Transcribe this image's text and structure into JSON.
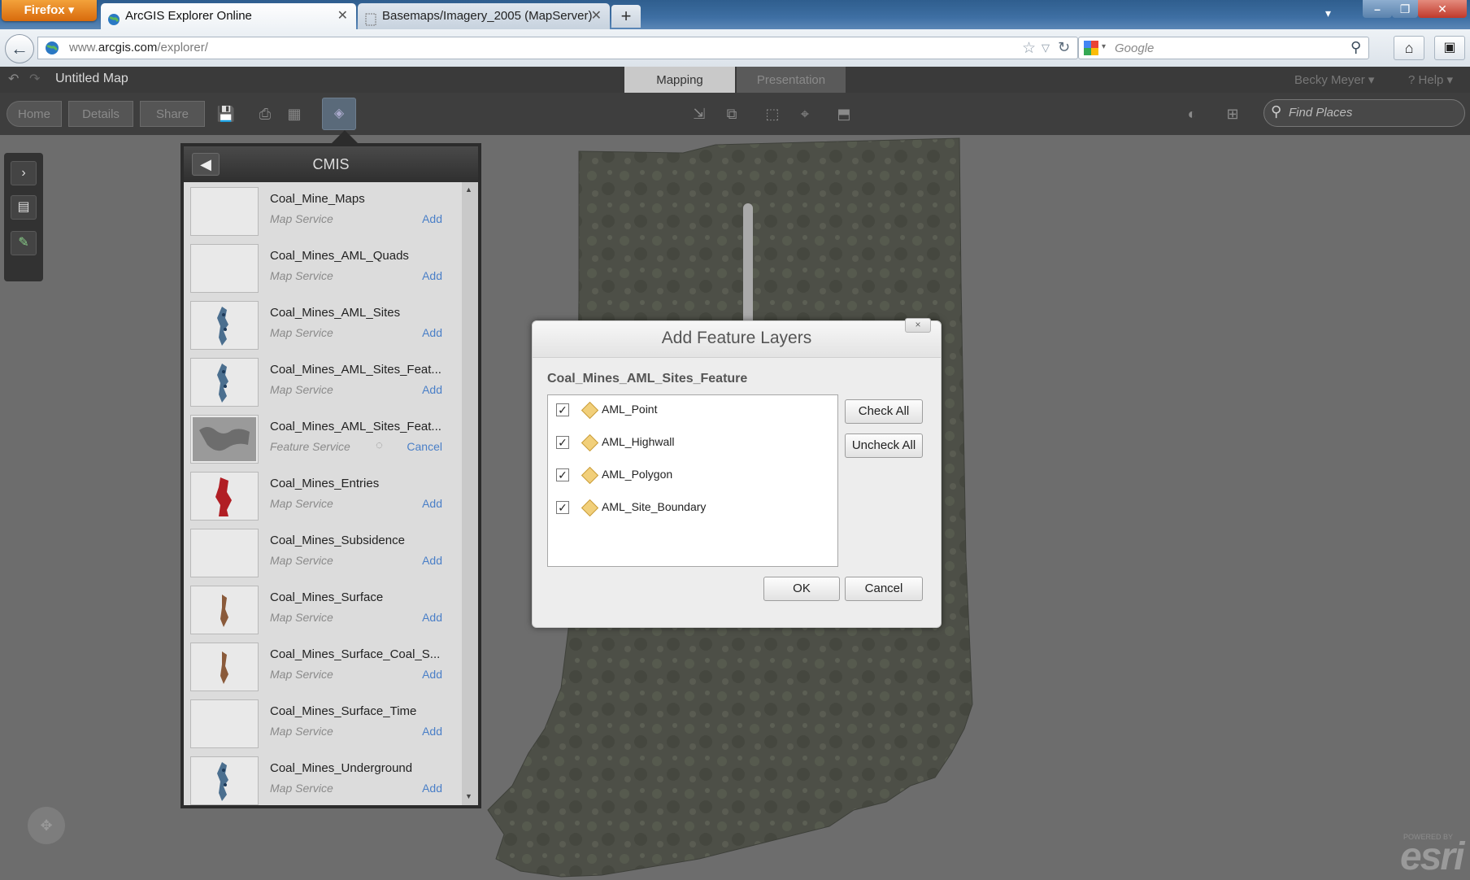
{
  "browser": {
    "app_button": "Firefox",
    "tabs": [
      {
        "title": "ArcGIS Explorer Online",
        "active": true
      },
      {
        "title": "Basemaps/Imagery_2005 (MapServer)",
        "active": false
      }
    ],
    "url_prefix": "www.",
    "url_domain": "arcgis.com",
    "url_path": "/explorer/",
    "search_placeholder": "Google",
    "new_tab": "+"
  },
  "app": {
    "map_title": "Untitled Map",
    "mode_tabs": [
      {
        "label": "Mapping",
        "active": true
      },
      {
        "label": "Presentation",
        "active": false
      }
    ],
    "user": "Becky Meyer",
    "help": "Help",
    "nav_buttons": [
      "Home",
      "Details",
      "Share"
    ],
    "find_places_placeholder": "Find Places"
  },
  "cmis": {
    "title": "CMIS",
    "items": [
      {
        "name": "Coal_Mine_Maps",
        "type": "Map Service",
        "action": "Add"
      },
      {
        "name": "Coal_Mines_AML_Quads",
        "type": "Map Service",
        "action": "Add"
      },
      {
        "name": "Coal_Mines_AML_Sites",
        "type": "Map Service",
        "action": "Add"
      },
      {
        "name": "Coal_Mines_AML_Sites_Feat...",
        "type": "Map Service",
        "action": "Add"
      },
      {
        "name": "Coal_Mines_AML_Sites_Feat...",
        "type": "Feature Service",
        "action": "Cancel"
      },
      {
        "name": "Coal_Mines_Entries",
        "type": "Map Service",
        "action": "Add"
      },
      {
        "name": "Coal_Mines_Subsidence",
        "type": "Map Service",
        "action": "Add"
      },
      {
        "name": "Coal_Mines_Surface",
        "type": "Map Service",
        "action": "Add"
      },
      {
        "name": "Coal_Mines_Surface_Coal_S...",
        "type": "Map Service",
        "action": "Add"
      },
      {
        "name": "Coal_Mines_Surface_Time",
        "type": "Map Service",
        "action": "Add"
      },
      {
        "name": "Coal_Mines_Underground",
        "type": "Map Service",
        "action": "Add"
      }
    ]
  },
  "dialog": {
    "title": "Add Feature Layers",
    "close": "×",
    "subtitle": "Coal_Mines_AML_Sites_Feature",
    "layers": [
      {
        "name": "AML_Point",
        "checked": true
      },
      {
        "name": "AML_Highwall",
        "checked": true
      },
      {
        "name": "AML_Polygon",
        "checked": true
      },
      {
        "name": "AML_Site_Boundary",
        "checked": true
      }
    ],
    "check_all": "Check All",
    "uncheck_all": "Uncheck All",
    "ok": "OK",
    "cancel": "Cancel"
  },
  "branding": {
    "logo": "esri",
    "powered_by": "POWERED BY"
  },
  "colors": {
    "link": "#4a7fc7",
    "layer_symbol": "#f1cf7a",
    "firefox_orange": "#e8830f"
  }
}
